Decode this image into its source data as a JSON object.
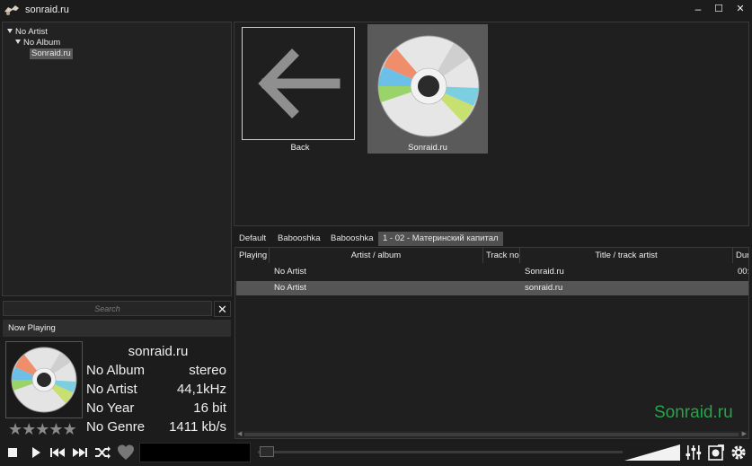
{
  "window": {
    "title": "sonraid.ru",
    "minimize": "–",
    "maximize": "☐",
    "close": "✕"
  },
  "tree": {
    "items": [
      {
        "label": "No Artist",
        "depth": 0,
        "expanded": true
      },
      {
        "label": "No Album",
        "depth": 1,
        "expanded": true
      },
      {
        "label": "Sonraid.ru",
        "depth": 2,
        "selected": true
      }
    ]
  },
  "search": {
    "placeholder": "Search",
    "clear": "✕"
  },
  "now_playing": {
    "header": "Now Playing",
    "title": "sonraid.ru",
    "album": "No Album",
    "artist": "No Artist",
    "year": "No Year",
    "genre": "No Genre",
    "channels": "stereo",
    "samplerate": "44,1kHz",
    "bitdepth": "16 bit",
    "bitrate": "1411 kb/s",
    "rating_stars": "★★★★★",
    "rating": 0
  },
  "grid": {
    "tiles": [
      {
        "label": "Back",
        "icon": "back-arrow-icon"
      },
      {
        "label": "Sonraid.ru",
        "icon": "cd-icon",
        "selected": true
      }
    ]
  },
  "playlist_tabs": [
    {
      "label": "Default"
    },
    {
      "label": "Babooshka"
    },
    {
      "label": "Babooshka"
    },
    {
      "label": "1 - 02 - Материнский капитал",
      "active": true
    }
  ],
  "playlist": {
    "columns": [
      "Playing",
      "Artist / album",
      "Track no",
      "Title / track artist",
      "Dur"
    ],
    "rows": [
      {
        "playing": "",
        "artist": "No Artist",
        "track": "",
        "title": "Sonraid.ru",
        "duration": "00:"
      },
      {
        "playing": "",
        "artist": "No Artist",
        "track": "",
        "title": "sonraid.ru",
        "duration": "",
        "selected": true
      }
    ]
  },
  "watermark": "Sonraid.ru",
  "colors": {
    "background": "#1c1c1c",
    "selection": "#555555",
    "watermark": "#27a34a"
  }
}
